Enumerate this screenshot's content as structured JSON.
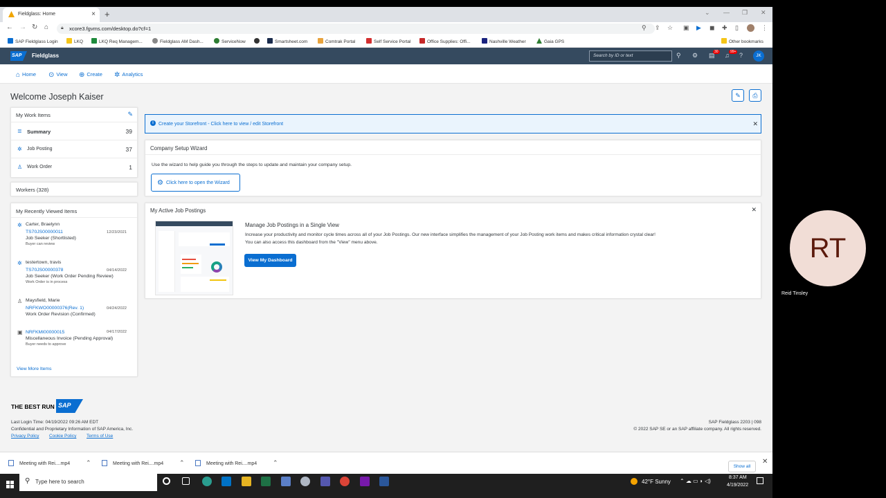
{
  "browser": {
    "tab_title": "Fieldglass: Home",
    "url": "xcore3.fgvms.com/desktop.do?cf=1",
    "bookmarks": [
      {
        "label": "SAP Fieldglass Login",
        "color": "#0a6ed1"
      },
      {
        "label": "LKQ",
        "color": "#f5c518"
      },
      {
        "label": "LKQ Req Managem...",
        "color": "#1e8a3c"
      },
      {
        "label": "Fieldglass AM Dash...",
        "color": "#888888"
      },
      {
        "label": "ServiceNow",
        "color": "#2e7d32"
      },
      {
        "label": "",
        "color": "#333333"
      },
      {
        "label": "Smartsheet.com",
        "color": "#1a2b4c"
      },
      {
        "label": "Comtrak Portal",
        "color": "#e8a33d"
      },
      {
        "label": "Self Service Portal",
        "color": "#d32f2f"
      },
      {
        "label": "Office Supplies: Offi...",
        "color": "#c62828"
      },
      {
        "label": "Nashville Weather",
        "color": "#1a237e"
      },
      {
        "label": "Gaia GPS",
        "color": "#2e7d32"
      }
    ],
    "other_bookmarks": "Other bookmarks"
  },
  "shell": {
    "logo": "SAP",
    "app_name": "Fieldglass",
    "env_tag": "",
    "search_placeholder": "Search by ID or text",
    "notif_badge": "99+",
    "tasks_badge": "30",
    "avatar": "JK"
  },
  "menu": {
    "home": "Home",
    "view": "View",
    "create": "Create",
    "analytics": "Analytics"
  },
  "welcome": "Welcome Joseph Kaiser",
  "work_items": {
    "title": "My Work Items",
    "rows": [
      {
        "label": "Summary",
        "count": "39"
      },
      {
        "label": "Job Posting",
        "count": "37"
      },
      {
        "label": "Work Order",
        "count": "1"
      }
    ]
  },
  "workers": "Workers (328)",
  "recent": {
    "title": "My Recently Viewed Items",
    "items": [
      {
        "name": "Carter, Braelynn",
        "id": "TS70JS00000011",
        "date": "12/23/2021",
        "status": "Job Seeker (Shortlisted)",
        "note": "Buyer can review"
      },
      {
        "name": "testertown, travis",
        "id": "TS70JS00000378",
        "date": "04/14/2022",
        "status": "Job Seeker (Work Order Pending Review)",
        "note": "Work Order is in process"
      },
      {
        "name": "Maysfield, Marie",
        "id": "NRFKWO00000376(Rev. 1)",
        "date": "04/24/2022",
        "status": "Work Order Revision (Confirmed)",
        "note": ""
      },
      {
        "name": "",
        "id": "NRFKMI00000015",
        "date": "04/17/2022",
        "status": "Miscellaneous Invoice (Pending Approval)",
        "note": "Buyer needs to approve"
      }
    ],
    "view_more": "View More Items"
  },
  "storefront": "Create your Storefront - Click here to view / edit Storefront",
  "wizard": {
    "title": "Company Setup Wizard",
    "desc": "Use the wizard to help guide you through the steps to update and maintain your company setup.",
    "button": "Click here to open the Wizard"
  },
  "postings": {
    "title": "My Active Job Postings",
    "heading": "Manage Job Postings in a Single View",
    "line1": "Increase your productivity and monitor cycle times across all of your Job Postings. Our new interface simplifies the management of your Job Posting work items and makes critical information crystal clear!",
    "line2": "You can also access this dashboard from the \"View\" menu above.",
    "button": "View My Dashboard"
  },
  "footer": {
    "brand": "THE BEST RUN",
    "last_login": "Last Login Time: 04/19/2022 09:26 AM EDT",
    "confidential": "Confidential and Proprietary Information of SAP America, Inc.",
    "privacy": "Privacy Policy",
    "cookie": "Cookie Policy",
    "terms": "Terms of Use",
    "version": "SAP Fieldglass 2203 | 098",
    "copyright": "© 2022 SAP SE or an SAP affiliate company. All rights reserved."
  },
  "downloads": {
    "items": [
      "Meeting with Rei....mp4",
      "Meeting with Rei....mp4",
      "Meeting with Rei....mp4"
    ],
    "show_all": "Show all"
  },
  "taskbar": {
    "search": "Type here to search",
    "weather": "42°F  Sunny",
    "time": "8:37 AM",
    "date": "4/19/2022"
  },
  "meeting": {
    "initials": "RT",
    "name": "Reid Tinsley"
  }
}
